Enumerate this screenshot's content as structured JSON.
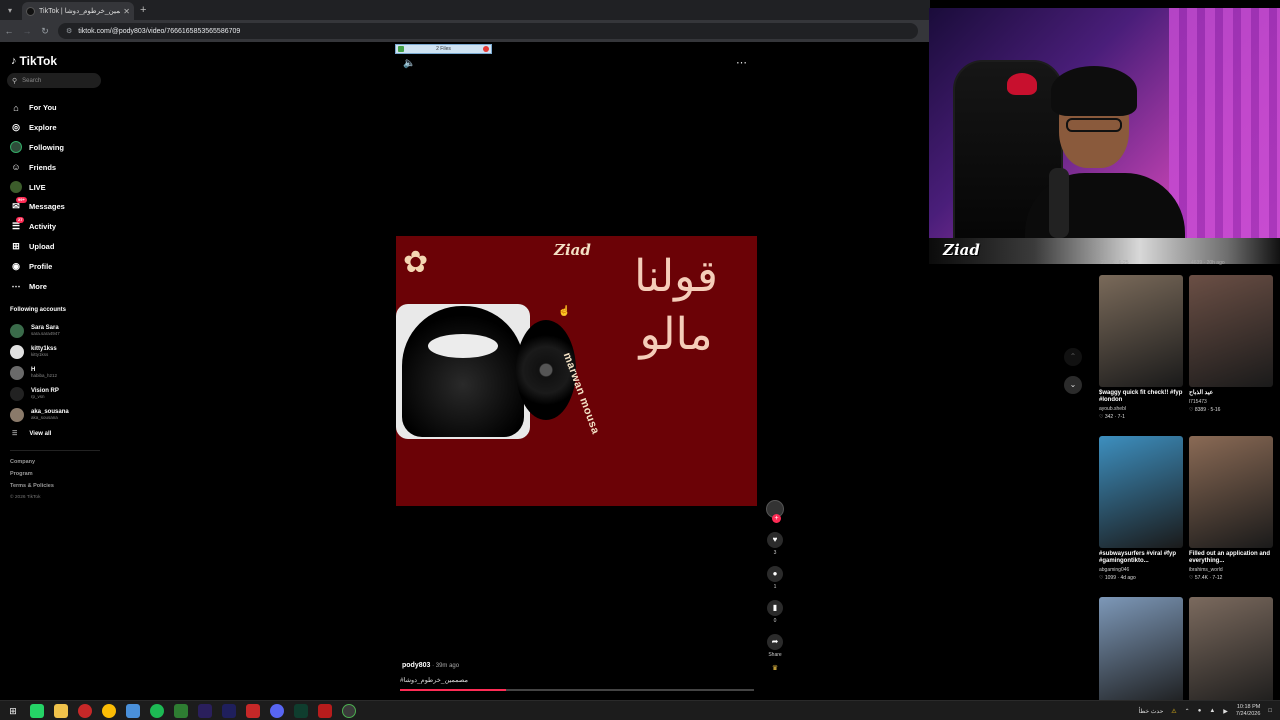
{
  "browser": {
    "tab_title": "TikTok | مصممين_خرطوم_دوشا#",
    "url": "tiktok.com/@pody803/video/7666165853565586709",
    "files_pill": "2 Files"
  },
  "sidebar": {
    "logo": "TikTok",
    "search_placeholder": "Search",
    "nav": [
      {
        "label": "For You",
        "icon": "home-icon"
      },
      {
        "label": "Explore",
        "icon": "compass-icon"
      },
      {
        "label": "Following",
        "icon": "avatar-icon"
      },
      {
        "label": "Friends",
        "icon": "friends-icon"
      },
      {
        "label": "LIVE",
        "icon": "live-icon"
      },
      {
        "label": "Messages",
        "icon": "message-icon",
        "badge": "99+"
      },
      {
        "label": "Activity",
        "icon": "activity-icon",
        "badge": "27"
      },
      {
        "label": "Upload",
        "icon": "upload-icon"
      },
      {
        "label": "Profile",
        "icon": "profile-icon"
      },
      {
        "label": "More",
        "icon": "more-icon"
      }
    ],
    "following_title": "Following accounts",
    "accounts": [
      {
        "name": "Sara Sara",
        "handle": "sara.sara4947"
      },
      {
        "name": "kitty1kss",
        "handle": "kitty1kss"
      },
      {
        "name": "H",
        "handle": "habiba_h212"
      },
      {
        "name": "Vision RP",
        "handle": "rp_vsn"
      },
      {
        "name": "aka_sousana",
        "handle": "aka_sousana"
      }
    ],
    "view_all": "View all",
    "footer": [
      "Company",
      "Program",
      "Terms & Policies"
    ],
    "copyright": "© 2026 TikTok"
  },
  "video": {
    "brand": "Ziad",
    "artist_text": "marwan mousa",
    "arabic_title_line1": "قولنا",
    "arabic_title_line2": "مالو",
    "author": "pody803",
    "time": " · 39m ago",
    "caption": "مصممين_خرطوم_دوشا#",
    "progress": 0.3,
    "likes": "3",
    "comments": "1",
    "saves": "0",
    "share_label": "Share"
  },
  "recommended": {
    "top_left_meta": "23.9K · 6-25",
    "top_right_meta": "4639 · 20h ago",
    "cards": [
      {
        "title": "$waggy quick fit check!! #fyp #london",
        "author": "ayoub.shebl",
        "likes": "342",
        "date": "7-1",
        "thumb_color": "#7a6a5a"
      },
      {
        "title": "عيد الذباح",
        "author": "l715473",
        "likes": "8389",
        "date": "5-16",
        "thumb_color": "#6b4f45"
      },
      {
        "title": "#subwaysurfers #viral #fyp #gamingontikto...",
        "author": "abgaming046",
        "likes": "1099",
        "date": "4d ago",
        "thumb_color": "#3d8fbf"
      },
      {
        "title": "Filled out an application and everything...",
        "author": "ibrahims_world",
        "likes": "57.4K",
        "date": "7-12",
        "thumb_color": "#8a6a55"
      },
      {
        "title": "",
        "author": "",
        "likes": "",
        "date": "",
        "thumb_color": "#7d98b8"
      },
      {
        "title": "",
        "author": "",
        "likes": "",
        "date": "",
        "thumb_color": "#7b6a5e"
      }
    ]
  },
  "taskbar": {
    "time": "10:18 PM",
    "date": "7/24/2026",
    "notice": "حدث خطأ"
  }
}
